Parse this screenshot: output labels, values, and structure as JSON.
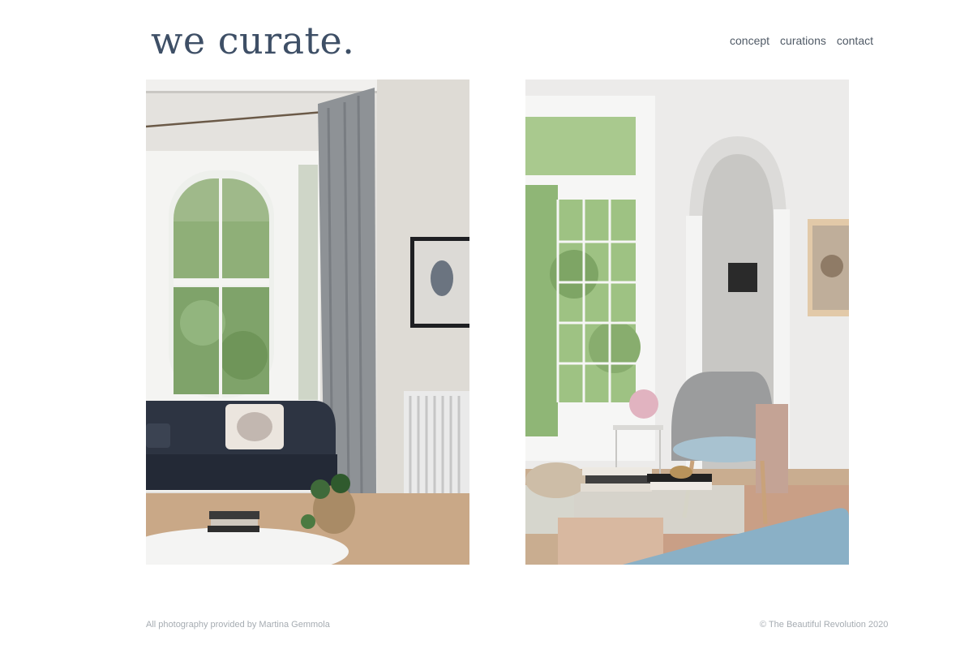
{
  "header": {
    "logo_text": "we curate.",
    "nav": [
      {
        "label": "concept"
      },
      {
        "label": "curations"
      },
      {
        "label": "contact"
      }
    ]
  },
  "gallery": {
    "photos": [
      {
        "subject": "living room with bay window, dark sofa, radiator and curtain"
      },
      {
        "subject": "living room with arched doorway, grey armchair and glass coffee table"
      }
    ]
  },
  "footer": {
    "credit": "All photography provided by Martina Gemmola",
    "copyright": "© The Beautiful Revolution 2020"
  },
  "colors": {
    "logo": "#3e4f66",
    "nav_text": "#505a66",
    "footer_text": "#a6acb2",
    "background": "#ffffff"
  }
}
